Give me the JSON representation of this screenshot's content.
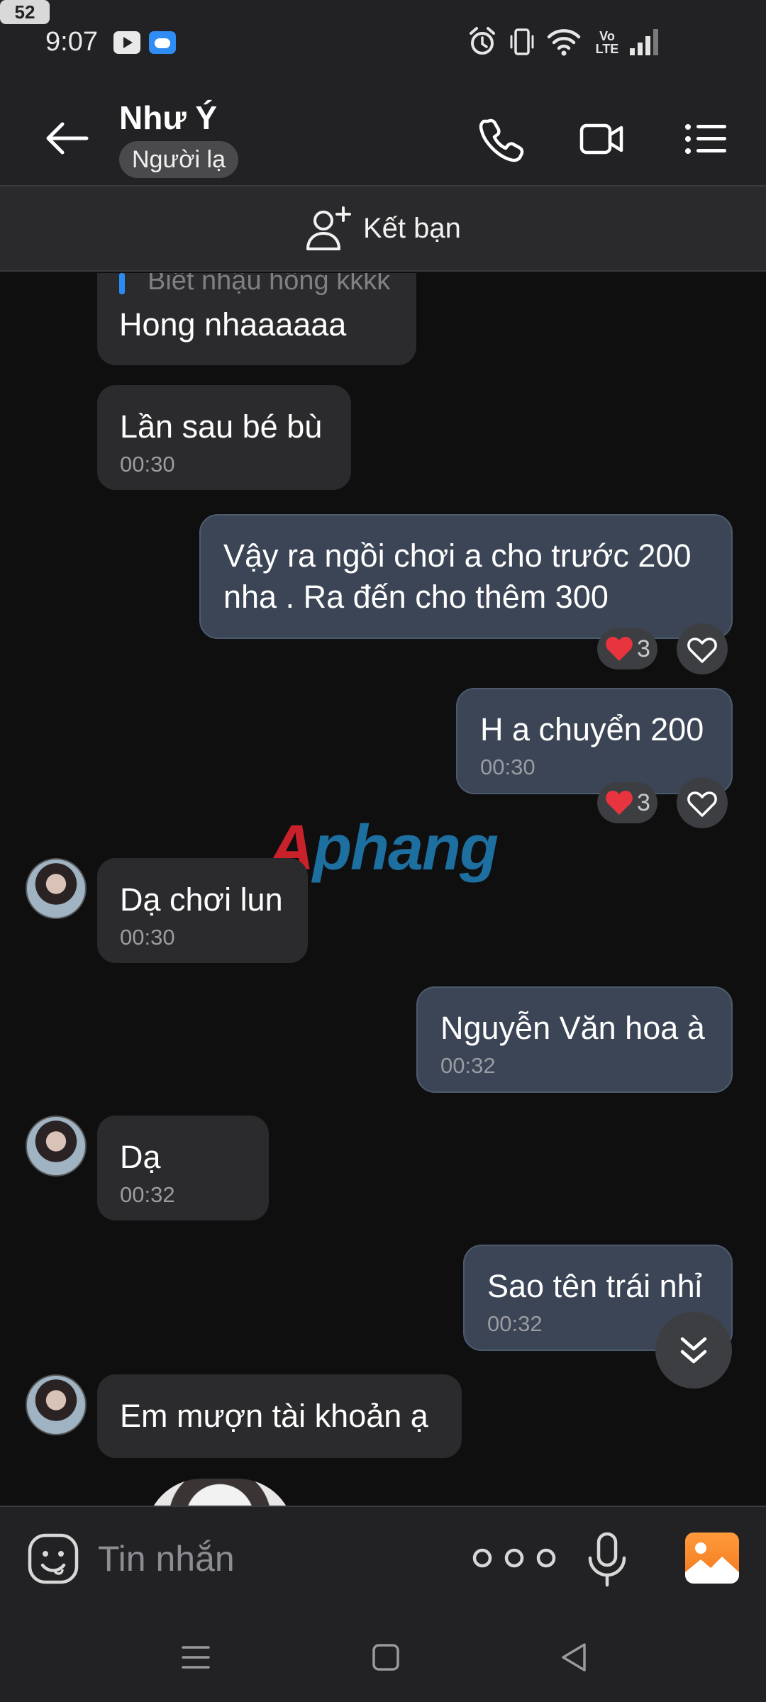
{
  "status_bar": {
    "time": "9:07",
    "network_label": "Vo\nLTE",
    "battery_level": "52",
    "icons": [
      "youtube-icon",
      "weather-icon",
      "alarm-icon",
      "vibrate-icon",
      "wifi-icon",
      "volte-icon",
      "signal-icon",
      "battery-icon"
    ]
  },
  "header": {
    "contact_name": "Như Ý",
    "badge": "Người lạ",
    "actions": [
      "call-icon",
      "video-call-icon",
      "menu-icon"
    ]
  },
  "add_friend": {
    "label": "Kết bạn"
  },
  "chat": {
    "quoted_text": "Biết nhậu hông kkkk",
    "messages": [
      {
        "direction": "incoming",
        "text": "Hong nhaaaaaa",
        "time": ""
      },
      {
        "direction": "incoming",
        "text": "Lần sau bé bù",
        "time": "00:30"
      },
      {
        "direction": "outgoing",
        "text": "Vậy ra ngồi chơi a cho trước 200\nnha . Ra đến cho thêm 300",
        "time": "",
        "reaction_count": "3"
      },
      {
        "direction": "outgoing",
        "text": "H a chuyển 200",
        "time": "00:30",
        "reaction_count": "3"
      },
      {
        "direction": "incoming",
        "text": "Dạ chơi lun",
        "time": "00:30"
      },
      {
        "direction": "outgoing",
        "text": "Nguyễn Văn hoa à",
        "time": "00:32"
      },
      {
        "direction": "incoming",
        "text": "Dạ",
        "time": "00:32"
      },
      {
        "direction": "outgoing",
        "text": "Sao tên trái nhỉ",
        "time": "00:32"
      },
      {
        "direction": "incoming",
        "text": "Em mượn tài khoản ạ",
        "time": ""
      }
    ],
    "watermark": {
      "first": "A",
      "rest": "phang"
    }
  },
  "input_bar": {
    "placeholder": "Tin nhắn",
    "actions": [
      "emoji-icon",
      "more-icon",
      "microphone-icon",
      "image-icon"
    ]
  },
  "nav_bar": {
    "buttons": [
      "menu-icon",
      "home-icon",
      "back-icon"
    ]
  },
  "colors": {
    "background": "#0f0f10",
    "bar": "#222224",
    "incoming_bubble": "#2b2b2d",
    "outgoing_bubble": "#3b4555",
    "heart": "#e8343f",
    "accent_blue": "#2a8cf2"
  }
}
